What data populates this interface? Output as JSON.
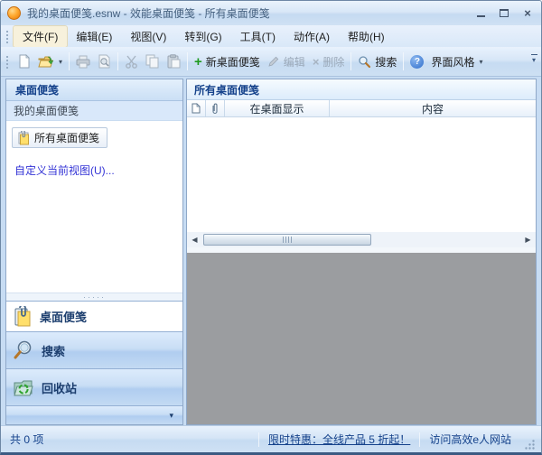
{
  "window": {
    "title": "我的桌面便笺.esnw - 效能桌面便笺 - 所有桌面便笺",
    "controls": {
      "close_glyph": "×"
    }
  },
  "menu": {
    "items": [
      "文件(F)",
      "编辑(E)",
      "视图(V)",
      "转到(G)",
      "工具(T)",
      "动作(A)",
      "帮助(H)"
    ]
  },
  "toolbar": {
    "new_note_label": "新桌面便笺",
    "edit_label": "编辑",
    "delete_label": "删除",
    "search_label": "搜索",
    "style_label": "界面风格",
    "dropdown_glyph": "▾"
  },
  "sidebar": {
    "header": "桌面便笺",
    "group": "我的桌面便笺",
    "selected_item": "所有桌面便笺",
    "customize_link": "自定义当前视图(U)...",
    "nav": [
      {
        "label": "桌面便笺",
        "active": true
      },
      {
        "label": "搜索",
        "active": false
      },
      {
        "label": "回收站",
        "active": false
      }
    ],
    "collapse_glyph": "▾"
  },
  "main": {
    "header": "所有桌面便笺",
    "columns": {
      "display_on_desktop": "在桌面显示",
      "content": "内容"
    },
    "scroll": {
      "left_glyph": "◀",
      "right_glyph": "▶"
    }
  },
  "statusbar": {
    "count": "共 0 项",
    "promo": "限时特惠：全线产品 5 折起！",
    "website": "访问高效e人网站"
  },
  "icons": {
    "app": "orange-ball",
    "new_doc": "blank-page",
    "open": "open-folder-green-arrow",
    "print": "printer",
    "preview": "print-preview",
    "cut": "scissors",
    "copy": "copy-pages",
    "paste": "clipboard",
    "add": "green-plus",
    "edit": "pencil",
    "delete": "gray-x",
    "search": "magnifier",
    "help": "blue-question-ball",
    "note": "yellow-sticky-note-clip",
    "recycle": "recycle-bin",
    "attachment": "paperclip",
    "document": "page"
  },
  "colors": {
    "frame_blue": "#c7dcf3",
    "header_text_blue": "#15428b",
    "selected_orange": "#ffb03f",
    "link_blue": "#3434d6",
    "empty_gray": "#9b9da0"
  }
}
